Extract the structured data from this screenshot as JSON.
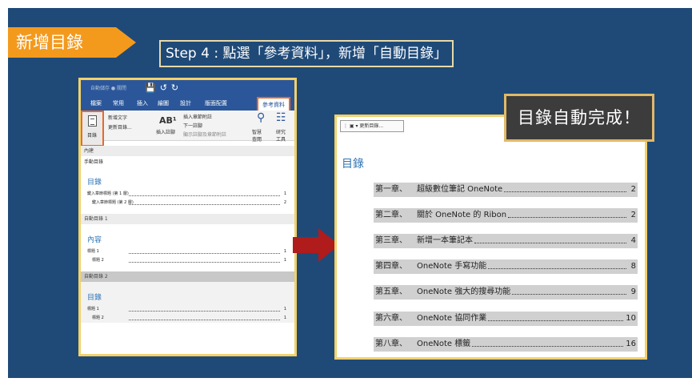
{
  "slide": {
    "section_title": "新增目錄",
    "step_text": "Step 4 : 點選「參考資料」，新增「自動目錄」",
    "callout": "目錄自動完成！"
  },
  "word_window": {
    "titlebar_text": "自動儲存 ● 關閉",
    "tabs": [
      "檔案",
      "常用",
      "插入",
      "繪圖",
      "設計",
      "版面配置",
      "參考資料"
    ],
    "active_tab": "參考資料",
    "ribbon": {
      "toc_button": "目錄",
      "add_text": "新增文字",
      "update_toc": "更新目錄...",
      "insert_footnote_label": "插入註腳",
      "insert_endnote": "插入章節附註",
      "next_footnote": "下一註腳",
      "show_notes": "顯示註腳及章節附註",
      "smart_lookup": "智慧查閱",
      "research": "研究工具"
    },
    "gallery": {
      "builtin_label": "內建",
      "manual_label": "手動目錄",
      "manual_title": "目錄",
      "manual_rows": [
        {
          "label": "鍵入章節標題 (第 1 層)",
          "page": "1"
        },
        {
          "label": "鍵入章節標題 (第 2 層)",
          "page": "2"
        }
      ],
      "auto1_label": "自動目錄 1",
      "auto1_title": "內容",
      "auto1_rows": [
        {
          "label": "標題 1",
          "page": "1"
        },
        {
          "label": "標題 2",
          "page": "1"
        }
      ],
      "auto2_label": "自動目錄 2",
      "auto2_title": "目錄",
      "auto2_rows": [
        {
          "label": "標題 1",
          "page": "1"
        },
        {
          "label": "標題 2",
          "page": "1"
        }
      ]
    }
  },
  "result_document": {
    "toolbar_text": "更新目錄...",
    "title": "目錄",
    "entries": [
      {
        "chapter": "第一章、",
        "title": "超級數位筆記 OneNote",
        "page": "2"
      },
      {
        "chapter": "第二章、",
        "title": "關於 OneNote 的 Ribon",
        "page": "2"
      },
      {
        "chapter": "第三章、",
        "title": "新增一本筆記本",
        "page": "4"
      },
      {
        "chapter": "第四章、",
        "title": "OneNote 手寫功能",
        "page": "8"
      },
      {
        "chapter": "第五章、",
        "title": "OneNote 強大的搜尋功能",
        "page": "9"
      },
      {
        "chapter": "第六章、",
        "title": "OneNote 協同作業",
        "page": "10"
      },
      {
        "chapter": "第八章、",
        "title": "OneNote 標籤",
        "page": "16"
      }
    ]
  },
  "colors": {
    "slide_bg": "#1f4a78",
    "tag": "#f39a1d",
    "arrow": "#b01b1b",
    "highlight_border": "#e66a2c",
    "frame": "#f2d16b"
  }
}
